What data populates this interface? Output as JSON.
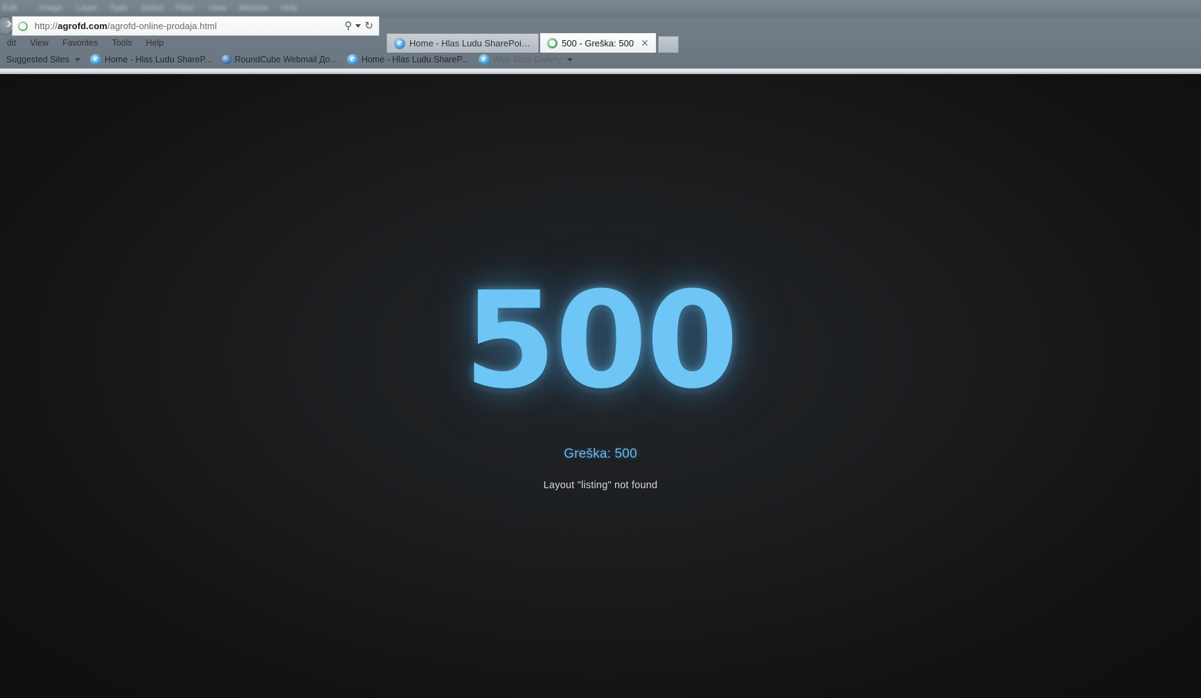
{
  "host_app_menu": {
    "items": [
      "Edit",
      "Image",
      "Layer",
      "Type",
      "Select",
      "Filter",
      "View",
      "Window",
      "Help"
    ]
  },
  "browser": {
    "address_bar": {
      "url_scheme": "http://",
      "url_host": "agrofd.com",
      "url_path": "/agrofd-online-prodaja.html",
      "favicon": "green-circle-favicon",
      "search_icon": "search-icon",
      "search_caret_icon": "chevron-down-icon",
      "refresh_icon": "refresh-icon",
      "refresh_glyph": "↻",
      "search_glyph": "⚲",
      "back_button": "back-arrow-icon"
    },
    "tabs": [
      {
        "title": "Home - Hlas Ludu SharePoint ...",
        "icon": "internet-explorer-icon",
        "active": false
      },
      {
        "title": "500 - Greška: 500",
        "icon": "green-circle-favicon",
        "active": true
      }
    ],
    "tab_close_label": "✕",
    "menu_bar": [
      "dit",
      "View",
      "Favorites",
      "Tools",
      "Help"
    ],
    "favorites_bar": [
      {
        "label": "Suggested Sites",
        "icon": "none",
        "has_caret": true,
        "dim": false
      },
      {
        "label": "Home - Hlas Ludu ShareP...",
        "icon": "internet-explorer-icon",
        "has_caret": false,
        "dim": false
      },
      {
        "label": "RoundCube Webmail  До...",
        "icon": "blue-ball-icon",
        "has_caret": false,
        "dim": false
      },
      {
        "label": "Home - Hlas Ludu ShareP...",
        "icon": "internet-explorer-icon",
        "has_caret": false,
        "dim": false
      },
      {
        "label": "Web Slice Gallery",
        "icon": "internet-explorer-icon",
        "has_caret": true,
        "dim": true
      }
    ]
  },
  "error_page": {
    "code": "500",
    "title": "Greška: 500",
    "message": "Layout \"listing\" not found",
    "colors": {
      "background": "#151515",
      "code": "#6ec6f7",
      "title": "#68b8ef",
      "message": "#d7d7d7"
    }
  }
}
